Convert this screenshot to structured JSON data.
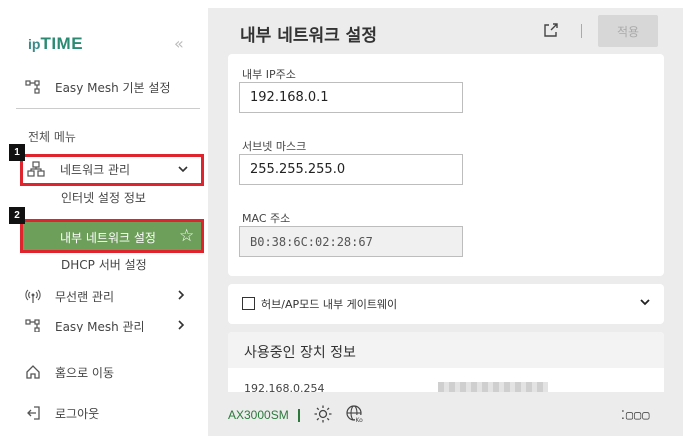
{
  "brand": {
    "logo_ip": "ip",
    "logo_time": "TIME",
    "collapse_glyph": "«"
  },
  "sidebar": {
    "easy_mesh_setup": "Easy Mesh 기본 설정",
    "section_label": "전체 메뉴",
    "network_mgmt": "네트워크 관리",
    "internet_settings": "인터넷 설정 정보",
    "internal_network": "내부 네트워크 설정",
    "dhcp_server": "DHCP 서버 설정",
    "wireless_mgmt": "무선랜 관리",
    "easy_mesh_mgmt": "Easy Mesh 관리",
    "home": "홈으로 이동",
    "logout": "로그아웃"
  },
  "annotations": {
    "badge1": "1",
    "badge2": "2"
  },
  "header": {
    "title": "내부 네트워크 설정",
    "apply": "적용"
  },
  "form": {
    "ip_label": "내부 IP주소",
    "ip_value": "192.168.0.1",
    "subnet_label": "서브넷 마스크",
    "subnet_value": "255.255.255.0",
    "mac_label": "MAC 주소",
    "mac_value": "B0:38:6C:02:28:67"
  },
  "gateway": {
    "label": "허브/AP모드 내부 게이트웨이",
    "checked": false
  },
  "devices": {
    "title": "사용중인 장치 정보",
    "row1_ip": "192.168.0.254"
  },
  "footer": {
    "model": "AX3000SM",
    "dots": "⁚▢▢▢"
  },
  "colors": {
    "active_bg": "#6d9f5b",
    "highlight_border": "#e0242d",
    "model_green": "#2b7a3c"
  }
}
